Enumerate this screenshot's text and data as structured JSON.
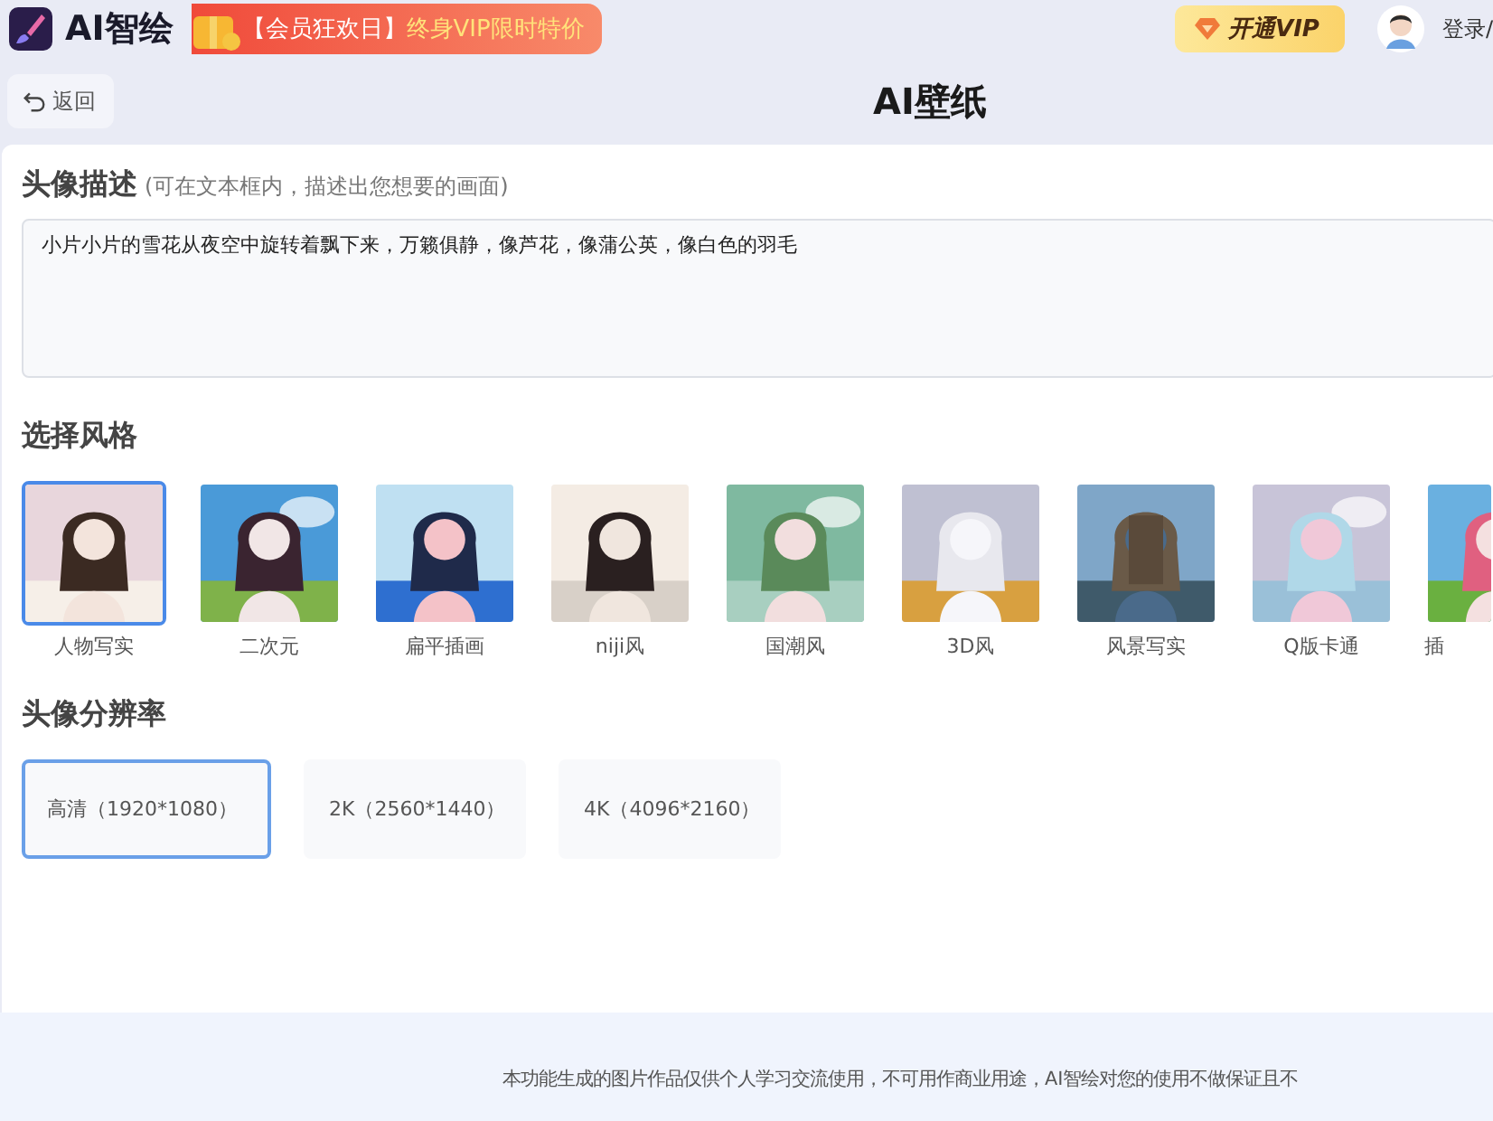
{
  "header": {
    "app_name": "AI智绘",
    "promo": {
      "tag": "【会员狂欢日】",
      "text": "终身VIP限时特价"
    },
    "vip_button": "开通VIP",
    "login": "登录/"
  },
  "toolbar": {
    "back": "返回",
    "title": "AI壁纸"
  },
  "description": {
    "title": "头像描述",
    "hint": "(可在文本框内，描述出您想要的画面)",
    "value": "小片小片的雪花从夜空中旋转着飘下来，万籁俱静，像芦花，像蒲公英，像白色的羽毛"
  },
  "styles": {
    "title": "选择风格",
    "items": [
      {
        "label": "人物写实",
        "selected": true
      },
      {
        "label": "二次元",
        "selected": false
      },
      {
        "label": "扁平插画",
        "selected": false
      },
      {
        "label": "niji风",
        "selected": false
      },
      {
        "label": "国潮风",
        "selected": false
      },
      {
        "label": "3D风",
        "selected": false
      },
      {
        "label": "风景写实",
        "selected": false
      },
      {
        "label": "Q版卡通",
        "selected": false
      },
      {
        "label": "插",
        "selected": false
      }
    ]
  },
  "resolution": {
    "title": "头像分辨率",
    "options": [
      {
        "label": "高清（1920*1080）",
        "selected": true
      },
      {
        "label": "2K（2560*1440）",
        "selected": false
      },
      {
        "label": "4K（4096*2160）",
        "selected": false
      }
    ]
  },
  "footer": "本功能生成的图片作品仅供个人学习交流使用，不可用作商业用途，AI智绘对您的使用不做保证且不"
}
